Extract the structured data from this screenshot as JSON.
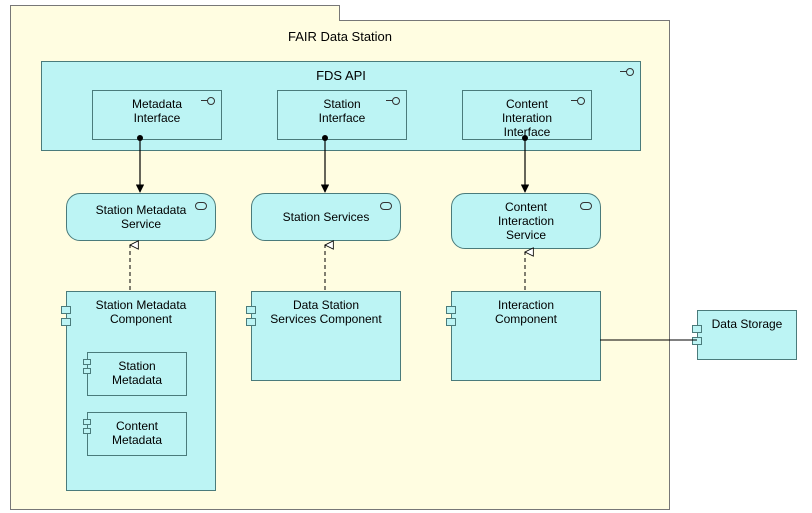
{
  "pkg": {
    "title": "FAIR Data Station",
    "api_title": "FDS API",
    "interfaces": {
      "metadata": "Metadata<br>Interface",
      "station": "Station<br>Interface",
      "content": "Content<br>Interation<br>Interface"
    },
    "services": {
      "metadata": "Station Metadata<br>Service",
      "station": "Station Services",
      "content": "Content<br>Interaction<br>Service"
    },
    "components": {
      "metadata": "Station Metadata<br>Component",
      "station": "Data Station<br>Services Component",
      "interaction": "Interaction<br>Component",
      "station_meta_inner": "Station<br>Metadata",
      "content_meta_inner": "Content<br>Metadata"
    }
  },
  "external": {
    "data_storage": "Data Storage"
  }
}
